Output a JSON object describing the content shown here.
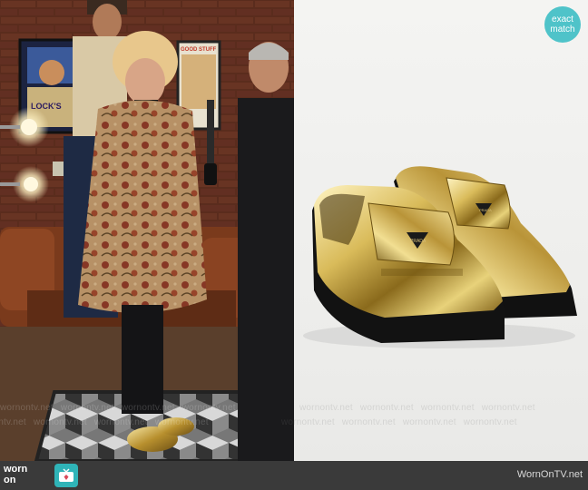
{
  "badge": {
    "line1": "exact",
    "line2": "match",
    "color": "#4fc3c9"
  },
  "watermark": {
    "text": "wornontv.net"
  },
  "footer": {
    "logo_line1": "worn",
    "logo_line2": "on",
    "logo_icon": "tv-icon",
    "site": "WornOnTV.net",
    "bar_color": "#3a3a3a",
    "accent_color": "#2fb4b8"
  },
  "scene": {
    "poster_left_text": "LOCK'S",
    "poster_right_text": "GOOD STUFF"
  }
}
